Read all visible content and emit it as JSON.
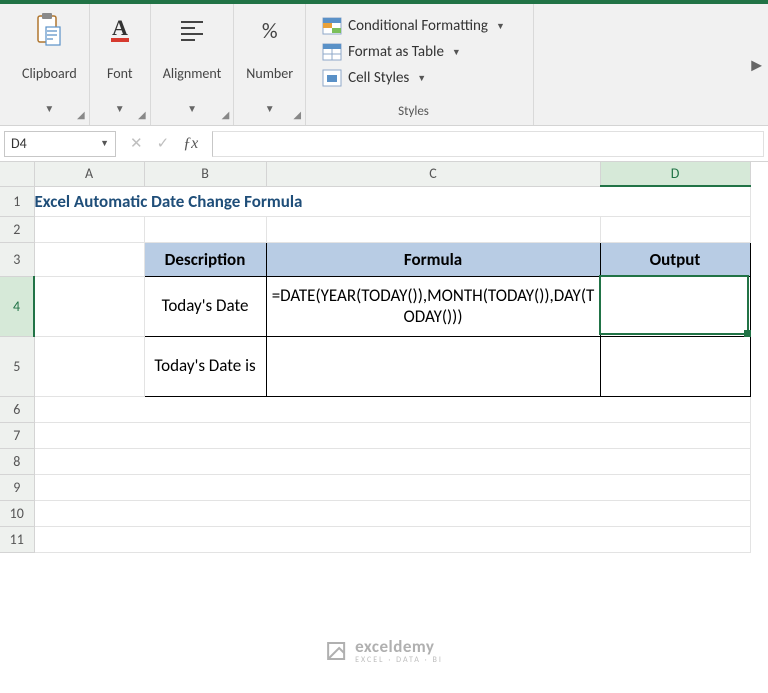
{
  "ribbon": {
    "groups": {
      "clipboard": {
        "label": "Clipboard"
      },
      "font": {
        "label": "Font"
      },
      "alignment": {
        "label": "Alignment"
      },
      "number": {
        "label": "Number"
      }
    },
    "styles": {
      "label": "Styles",
      "conditional": "Conditional Formatting",
      "table": "Format as Table",
      "cell": "Cell Styles"
    }
  },
  "name_box": "D4",
  "formula_bar": "",
  "columns": [
    "A",
    "B",
    "C",
    "D"
  ],
  "rows": [
    "1",
    "2",
    "3",
    "4",
    "5",
    "6",
    "7",
    "8",
    "9",
    "10",
    "11"
  ],
  "sheet_title": "Excel Automatic Date Change Formula",
  "table": {
    "headers": {
      "b": "Description",
      "c": "Formula",
      "d": "Output"
    },
    "row4": {
      "b": "Today's Date",
      "c": "=DATE(YEAR(TODAY()),MONTH(TODAY()),DAY(TODAY()))",
      "d": ""
    },
    "row5": {
      "b": "Today's Date is",
      "c": "",
      "d": ""
    }
  },
  "watermark": {
    "name": "exceldemy",
    "tagline": "EXCEL · DATA · BI"
  },
  "selection": {
    "cell": "D4"
  }
}
